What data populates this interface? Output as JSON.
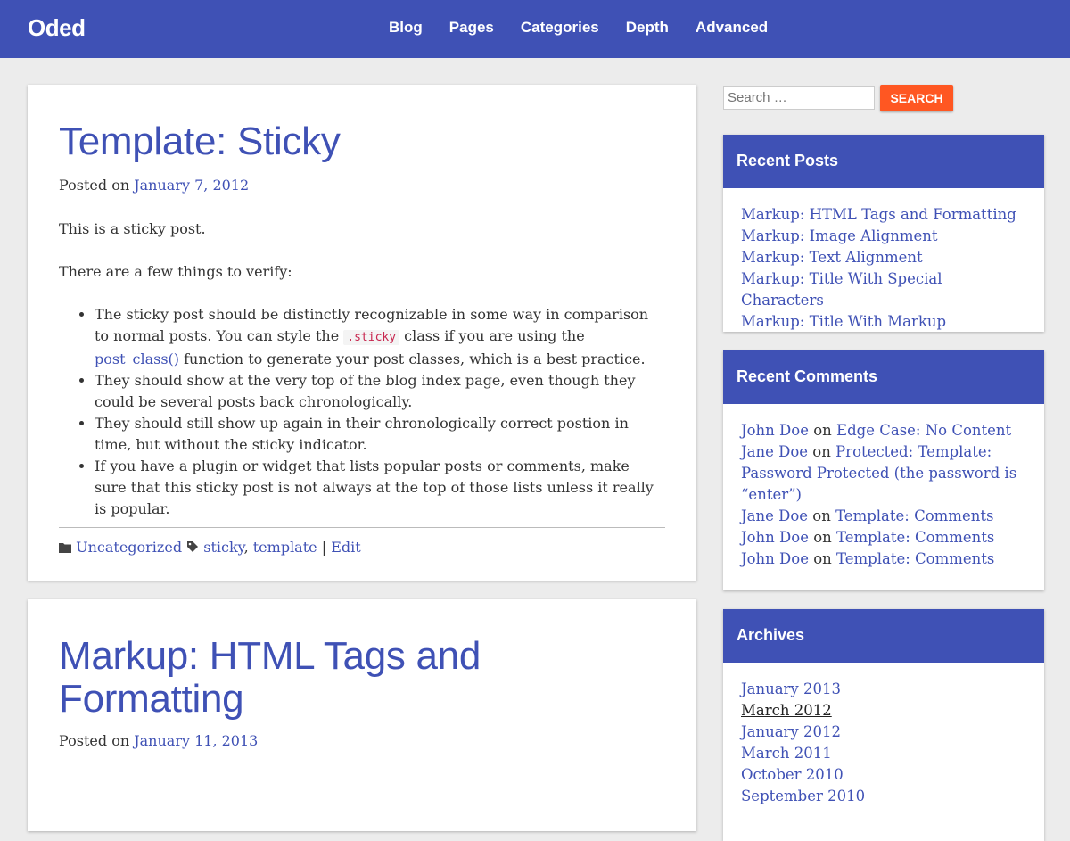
{
  "site": {
    "title": "Oded"
  },
  "nav": [
    "Blog",
    "Pages",
    "Categories",
    "Depth",
    "Advanced"
  ],
  "colors": {
    "primary": "#3f51b5",
    "accent": "#ff5722",
    "background": "#ececec"
  },
  "posts": [
    {
      "title": "Template: Sticky",
      "posted_on": "Posted on",
      "date": "January 7, 2012",
      "intro": "This is a sticky post.",
      "verify": "There are a few things to verify:",
      "bullet1_a": "The sticky post should be distinctly recognizable in some way in comparison to normal posts. You can style the ",
      "bullet1_code": ".sticky",
      "bullet1_b": " class if you are using the ",
      "bullet1_link": "post_class()",
      "bullet1_c": " function to generate your post classes, which is a best practice.",
      "bullet2": "They should show at the very top of the blog index page, even though they could be several posts back chronologically.",
      "bullet3": "They should still show up again in their chronologically correct postion in time, but without the sticky indicator.",
      "bullet4": "If you have a plugin or widget that lists popular posts or comments, make sure that this sticky post is not always at the top of those lists unless it really is popular.",
      "category": "Uncategorized",
      "tags": [
        "sticky",
        "template"
      ],
      "tag_sep": ", ",
      "edit_sep": " | ",
      "edit": "Edit",
      "category_icon": "folder-icon",
      "tag_icon": "tag-icon"
    },
    {
      "title": "Markup: HTML Tags and Formatting",
      "posted_on": "Posted on",
      "date": "January 11, 2013"
    }
  ],
  "search": {
    "placeholder": "Search …",
    "button": "SEARCH"
  },
  "recent_posts": {
    "title": "Recent Posts",
    "items": [
      "Markup: HTML Tags and Formatting",
      "Markup: Image Alignment",
      "Markup: Text Alignment",
      "Markup: Title With Special Characters",
      "Markup: Title With Markup"
    ]
  },
  "recent_comments": {
    "title": "Recent Comments",
    "on": " on ",
    "items": [
      {
        "author": "John Doe",
        "post": "Edge Case: No Content"
      },
      {
        "author": "Jane Doe",
        "post": "Protected: Template: Password Protected (the password is “enter”)"
      },
      {
        "author": "Jane Doe",
        "post": "Template: Comments"
      },
      {
        "author": "John Doe",
        "post": "Template: Comments"
      },
      {
        "author": "John Doe",
        "post": "Template: Comments"
      }
    ]
  },
  "archives": {
    "title": "Archives",
    "items": [
      "January 2013",
      "March 2012",
      "January 2012",
      "March 2011",
      "October 2010",
      "September 2010"
    ]
  }
}
